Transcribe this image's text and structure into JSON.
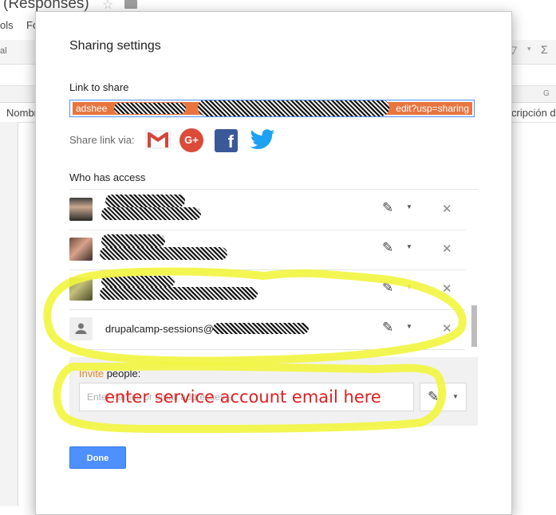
{
  "background": {
    "doc_title": "(Responses)",
    "menu_partial_1": "ols",
    "menu_partial_2": "Fo",
    "toolbar_partial": "al",
    "column_letter": "G",
    "header_left": "Nombr",
    "header_right": "cripción de"
  },
  "dialog": {
    "title": "Sharing settings",
    "link_label": "Link to share",
    "link_value_start": "adshee",
    "link_value_end": "edit?usp=sharing",
    "share_via_label": "Share link via:",
    "share_icons": [
      "gmail-icon",
      "google-plus-icon",
      "facebook-icon",
      "twitter-icon"
    ],
    "gplus_text": "G+",
    "fb_text": "f",
    "who_label": "Who has access",
    "people": [
      {
        "avatar": "man-photo",
        "email": "",
        "permission": "can-edit"
      },
      {
        "avatar": "woman-photo",
        "email": "",
        "permission": "can-edit"
      },
      {
        "avatar": "group-photo",
        "email": "",
        "permission": "can-edit"
      },
      {
        "avatar": "generic-person-icon",
        "email": "drupalcamp-sessions@",
        "permission": "can-edit"
      }
    ],
    "invite": {
      "label_a": "Invite",
      "label_b": " people:",
      "placeholder": "Enter names or email addresses...",
      "permission": "can-edit"
    },
    "done_label": "Done"
  },
  "annotation": {
    "text": "enter service account email here",
    "highlight_color": "#f4f542",
    "text_color": "#e02020"
  }
}
